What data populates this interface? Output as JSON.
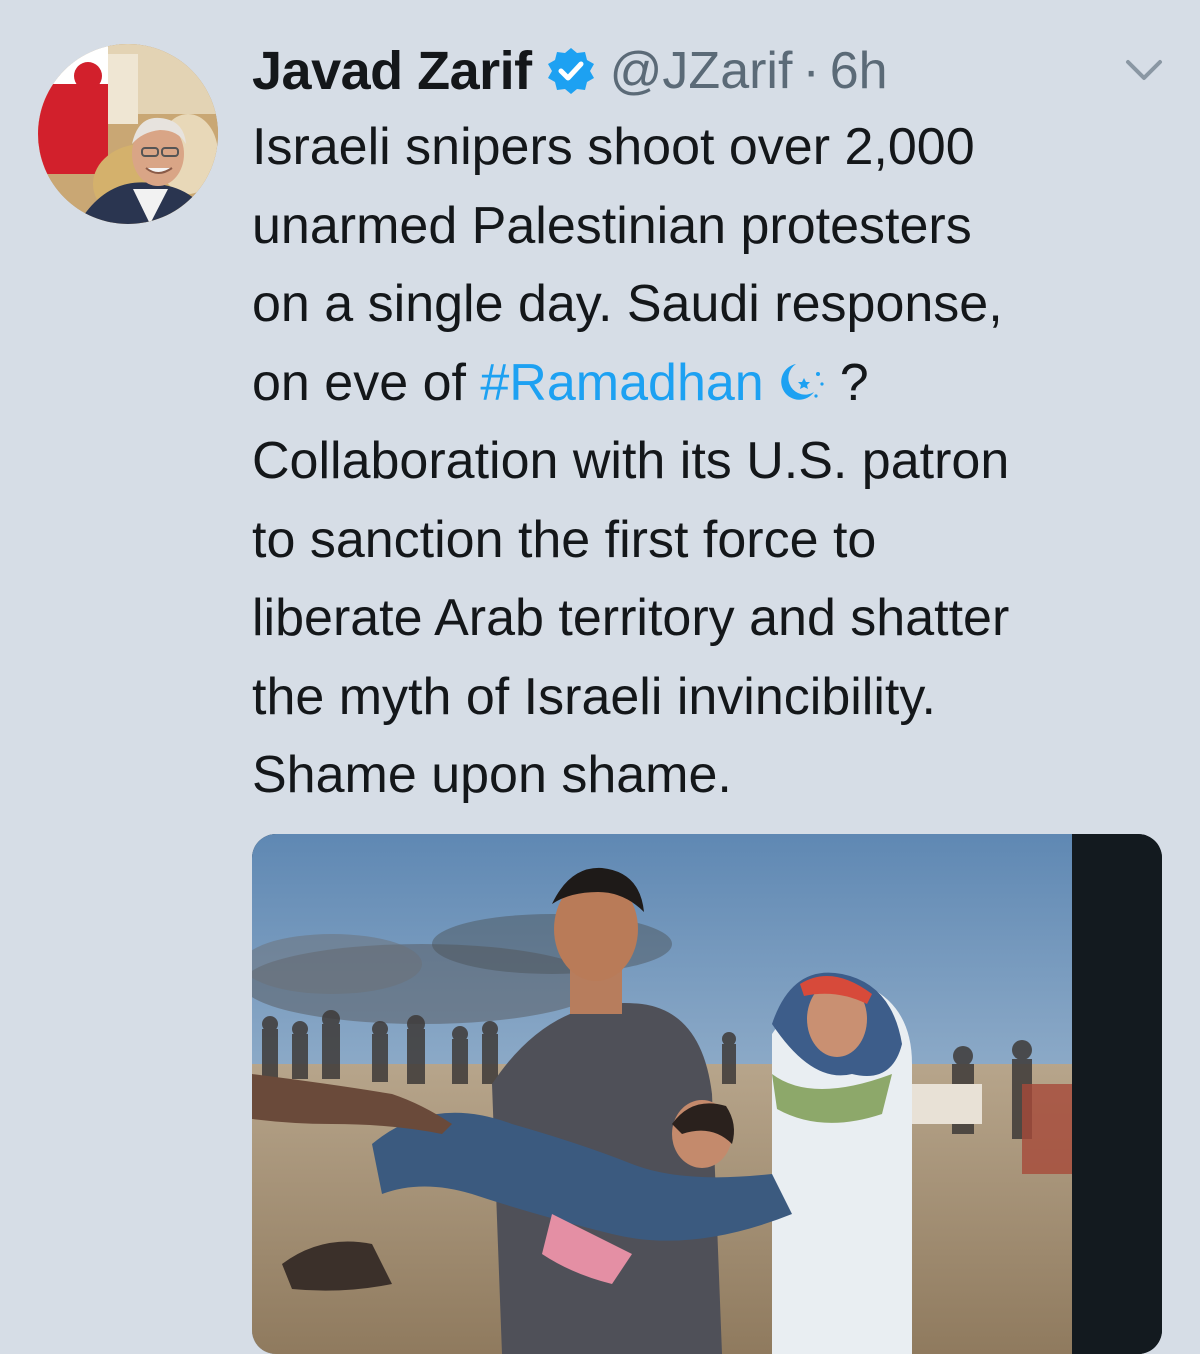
{
  "tweet": {
    "author_name": "Javad Zarif",
    "handle": "@JZarif",
    "separator": "·",
    "time": "6h",
    "text_lines": {
      "l1": "Israeli snipers shoot over 2,000",
      "l2": "unarmed Palestinian protesters",
      "l3": "on a single day. Saudi response,",
      "l4_pre": "on eve of ",
      "l4_hashtag": "#Ramadhan",
      "l4_post": "?",
      "l5": "Collaboration with its U.S. patron",
      "l6": "to sanction the first force to",
      "l7": "liberate Arab territory and shatter",
      "l8": "the myth of Israeli invincibility.",
      "l9": "Shame upon shame."
    }
  },
  "icons": {
    "verified": "verified-badge-icon",
    "caret": "chevron-down-icon",
    "moon": "crescent-moon-star-icon"
  },
  "colors": {
    "background": "#d6dde6",
    "text": "#14171a",
    "secondary_text": "#5b6a77",
    "link": "#1da1f2",
    "verified": "#1da1f2"
  }
}
